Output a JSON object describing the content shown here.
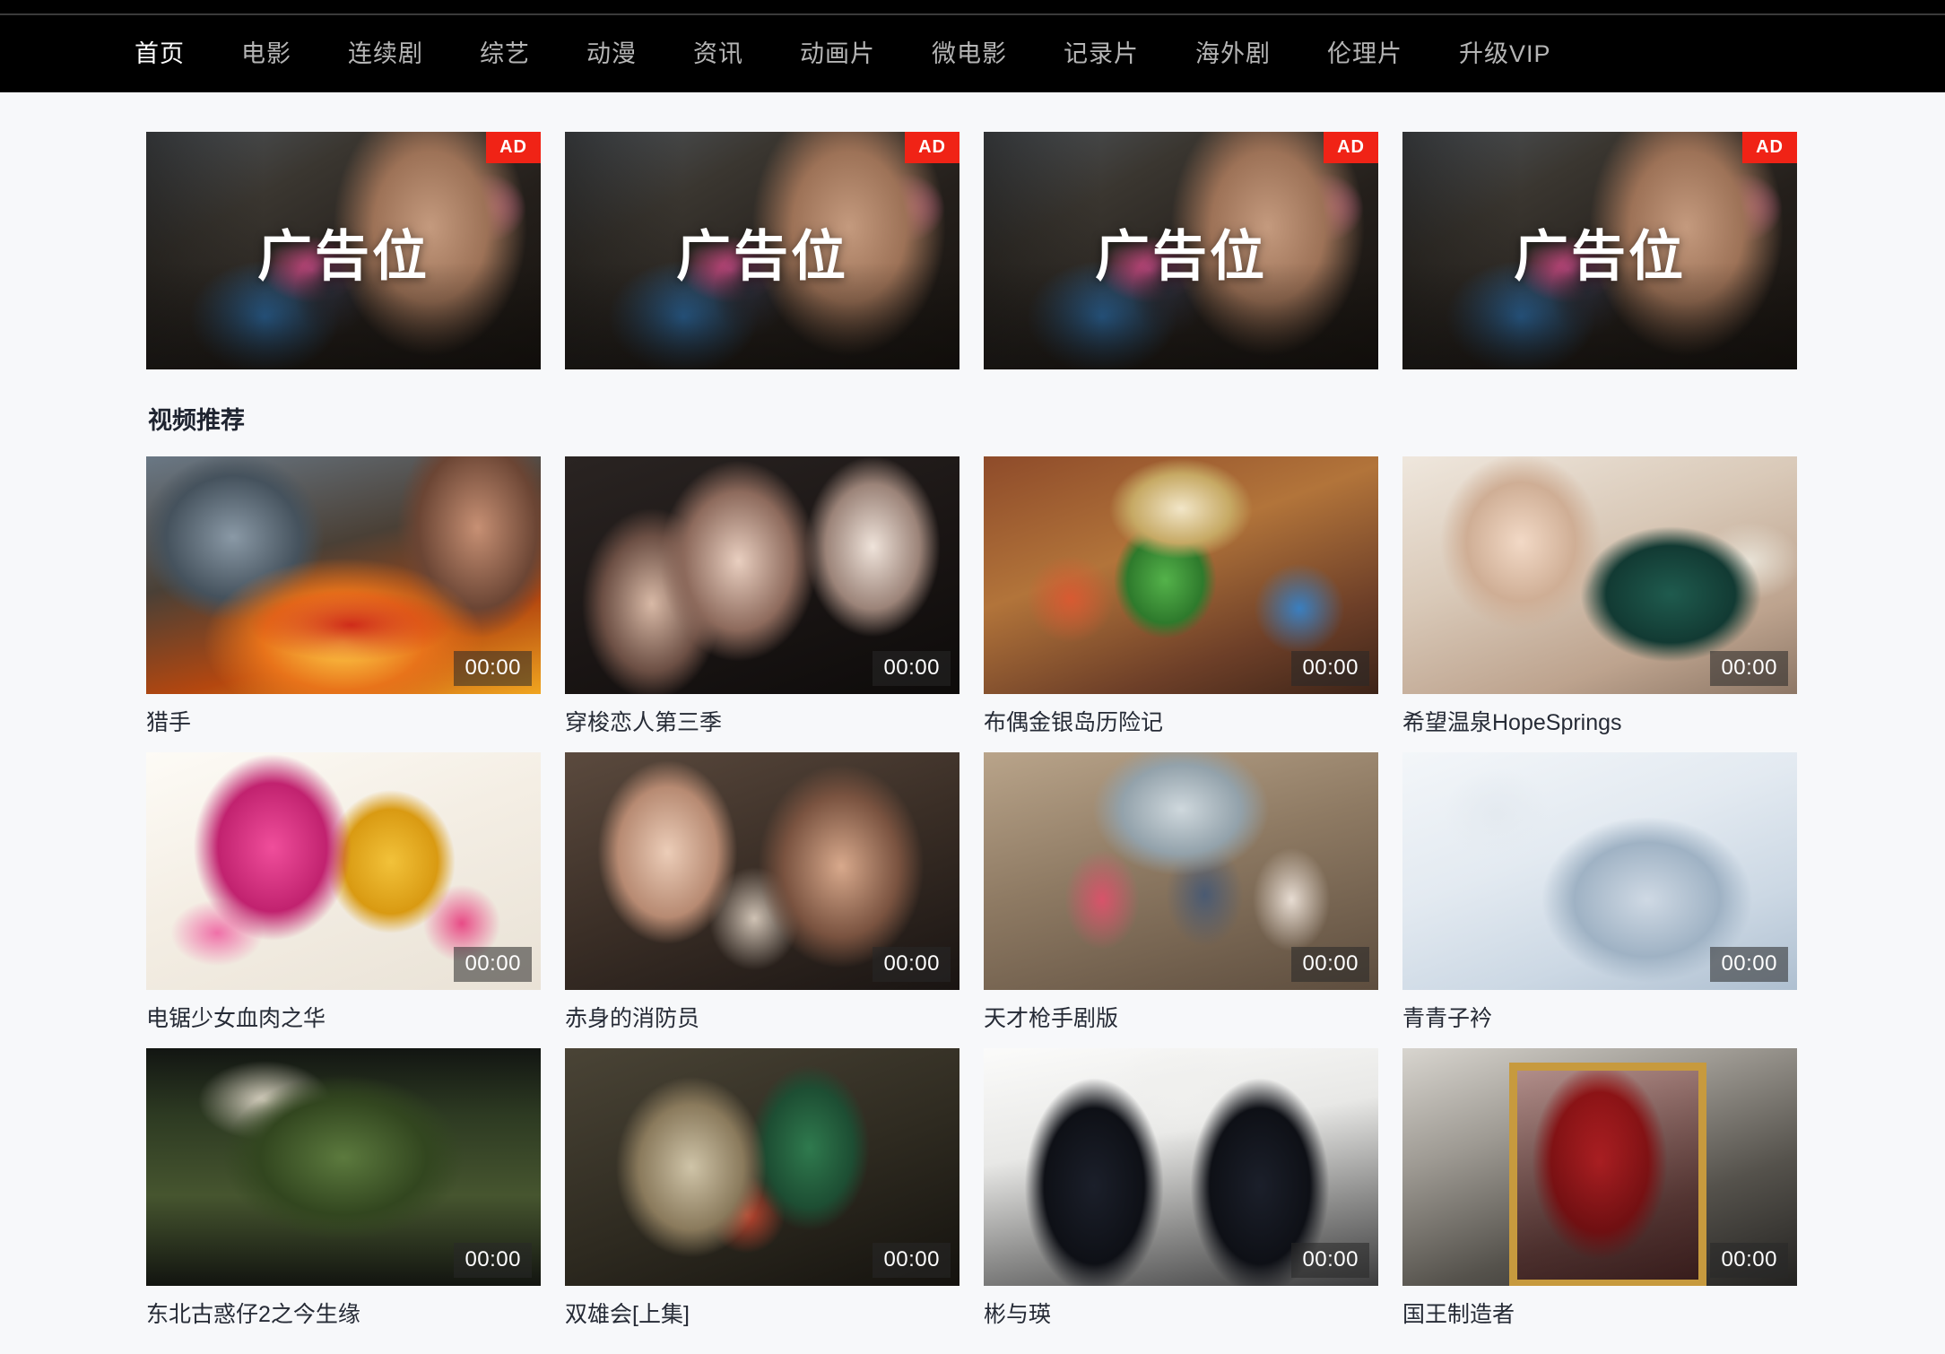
{
  "site": {
    "background_color": "#f7f8fa",
    "navbar_background_color": "#000000",
    "accent_color": "#f02316",
    "text_color": "#262b36"
  },
  "navbar": {
    "items": [
      {
        "label": "首页",
        "active": true
      },
      {
        "label": "电影",
        "active": false
      },
      {
        "label": "连续剧",
        "active": false
      },
      {
        "label": "综艺",
        "active": false
      },
      {
        "label": "动漫",
        "active": false
      },
      {
        "label": "资讯",
        "active": false
      },
      {
        "label": "动画片",
        "active": false
      },
      {
        "label": "微电影",
        "active": false
      },
      {
        "label": "记录片",
        "active": false
      },
      {
        "label": "海外剧",
        "active": false
      },
      {
        "label": "伦理片",
        "active": false
      },
      {
        "label": "升级VIP",
        "active": false
      }
    ]
  },
  "ads": {
    "badge_label": "AD",
    "items": [
      {
        "label": "广告位"
      },
      {
        "label": "广告位"
      },
      {
        "label": "广告位"
      },
      {
        "label": "广告位"
      }
    ]
  },
  "recommend": {
    "section_title": "视频推荐",
    "videos": [
      {
        "title": "猎手",
        "duration": "00:00",
        "art": "art-lieshou"
      },
      {
        "title": "穿梭恋人第三季",
        "duration": "00:00",
        "art": "art-chuansuo"
      },
      {
        "title": "布偶金银岛历险记",
        "duration": "00:00",
        "art": "art-budou"
      },
      {
        "title": "希望温泉HopeSprings",
        "duration": "00:00",
        "art": "art-hope"
      },
      {
        "title": "电锯少女血肉之华",
        "duration": "00:00",
        "art": "art-dianju"
      },
      {
        "title": "赤身的消防员",
        "duration": "00:00",
        "art": "art-chishen"
      },
      {
        "title": "天才枪手剧版",
        "duration": "00:00",
        "art": "art-tiancai"
      },
      {
        "title": "青青子衿",
        "duration": "00:00",
        "art": "art-qingqing"
      },
      {
        "title": "东北古惑仔2之今生缘",
        "duration": "00:00",
        "art": "art-dongbei"
      },
      {
        "title": "双雄会[上集]",
        "duration": "00:00",
        "art": "art-shuangxiong"
      },
      {
        "title": "彬与瑛",
        "duration": "00:00",
        "art": "art-binyuying"
      },
      {
        "title": "国王制造者",
        "duration": "00:00",
        "art": "art-guowang"
      }
    ]
  }
}
